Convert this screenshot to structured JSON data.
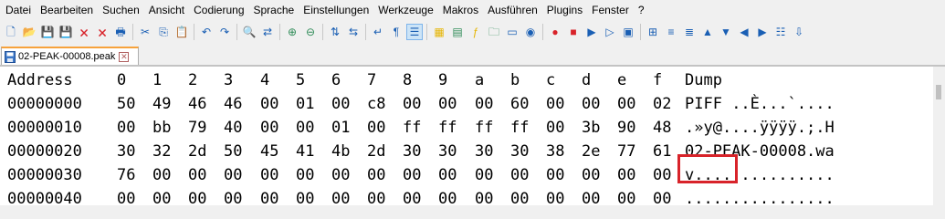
{
  "menu": [
    "Datei",
    "Bearbeiten",
    "Suchen",
    "Ansicht",
    "Codierung",
    "Sprache",
    "Einstellungen",
    "Werkzeuge",
    "Makros",
    "Ausführen",
    "Plugins",
    "Fenster",
    "?"
  ],
  "toolbar": {
    "icons": [
      "new-file-icon",
      "open-file-icon",
      "save-icon",
      "save-all-icon",
      "close-icon",
      "close-all-icon",
      "print-icon",
      "sep",
      "cut-icon",
      "copy-icon",
      "paste-icon",
      "sep",
      "undo-icon",
      "redo-icon",
      "sep",
      "find-icon",
      "replace-icon",
      "sep",
      "zoom-in-icon",
      "zoom-out-icon",
      "sep",
      "sync-vertical-icon",
      "sync-horizontal-icon",
      "sep",
      "word-wrap-icon",
      "show-all-chars-icon",
      "indent-guide-icon",
      "sep",
      "hex-view-icon",
      "doc-map-icon",
      "function-list-icon",
      "folder-workspace-icon",
      "doc-switcher-icon",
      "monitoring-icon",
      "sep",
      "record-macro-icon",
      "stop-record-icon",
      "play-macro-icon",
      "run-macro-multiple-icon",
      "save-macro-icon",
      "sep",
      "hex-insert-icon",
      "hex-columns-icon",
      "hex-compare-icon",
      "hex-up-icon",
      "hex-down-icon",
      "hex-left-icon",
      "hex-right-icon",
      "hex-options-icon",
      "hex-export-icon"
    ],
    "icon_colors": {
      "accent": "#1a5fb4",
      "red": "#d8232a",
      "green": "#2e8b57",
      "yellow": "#e5b400"
    }
  },
  "tab": {
    "label": "02-PEAK-00008.peak"
  },
  "hex": {
    "header": {
      "address": "Address",
      "columns": [
        "0",
        "1",
        "2",
        "3",
        "4",
        "5",
        "6",
        "7",
        "8",
        "9",
        "a",
        "b",
        "c",
        "d",
        "e",
        "f"
      ],
      "dump": "Dump"
    },
    "rows": [
      {
        "address": "00000000",
        "bytes": [
          "50",
          "49",
          "46",
          "46",
          "00",
          "01",
          "00",
          "c8",
          "00",
          "00",
          "00",
          "60",
          "00",
          "00",
          "00",
          "02"
        ],
        "dump_prefix": "PIFF",
        "dump_rest": " ..È...`...."
      },
      {
        "address": "00000010",
        "bytes": [
          "00",
          "bb",
          "79",
          "40",
          "00",
          "00",
          "01",
          "00",
          "ff",
          "ff",
          "ff",
          "ff",
          "00",
          "3b",
          "90",
          "48"
        ],
        "dump_prefix": "",
        "dump_rest": ".»y@....ÿÿÿÿ.;.H"
      },
      {
        "address": "00000020",
        "bytes": [
          "30",
          "32",
          "2d",
          "50",
          "45",
          "41",
          "4b",
          "2d",
          "30",
          "30",
          "30",
          "30",
          "38",
          "2e",
          "77",
          "61"
        ],
        "dump_prefix": "",
        "dump_rest": "02-PEAK-00008.wa"
      },
      {
        "address": "00000030",
        "bytes": [
          "76",
          "00",
          "00",
          "00",
          "00",
          "00",
          "00",
          "00",
          "00",
          "00",
          "00",
          "00",
          "00",
          "00",
          "00",
          "00"
        ],
        "dump_prefix": "",
        "dump_rest": "v..............."
      },
      {
        "address": "00000040",
        "bytes": [
          "00",
          "00",
          "00",
          "00",
          "00",
          "00",
          "00",
          "00",
          "00",
          "00",
          "00",
          "00",
          "00",
          "00",
          "00",
          "00"
        ],
        "dump_prefix": "",
        "dump_rest": "................"
      }
    ]
  },
  "highlight_color": "#d8232a"
}
